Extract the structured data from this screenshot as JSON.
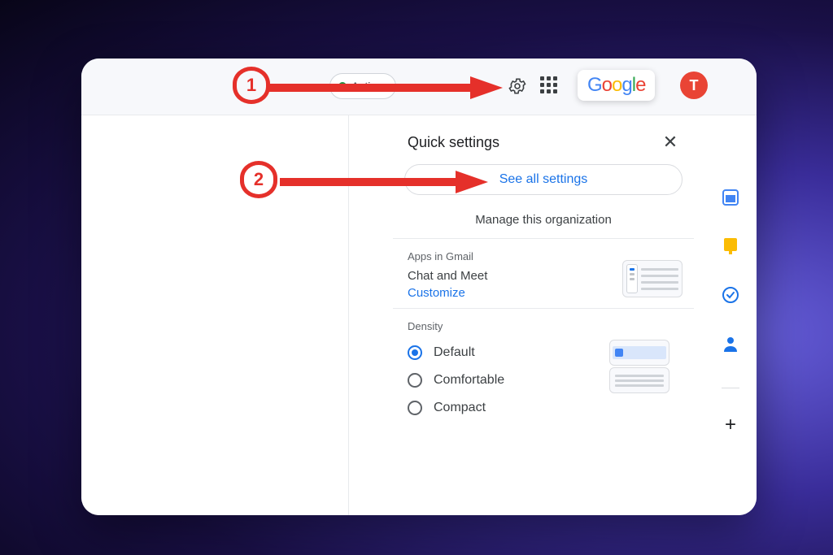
{
  "header": {
    "active_label": "Active",
    "logo_letters": [
      "G",
      "o",
      "o",
      "g",
      "l",
      "e"
    ],
    "avatar_initial": "T"
  },
  "panel": {
    "title": "Quick settings",
    "see_all_label": "See all settings",
    "manage_org_label": "Manage this organization",
    "apps_section_label": "Apps in Gmail",
    "apps_item_label": "Chat and Meet",
    "apps_customize_label": "Customize",
    "density_section_label": "Density",
    "density_options": [
      {
        "label": "Default",
        "selected": true
      },
      {
        "label": "Comfortable",
        "selected": false
      },
      {
        "label": "Compact",
        "selected": false
      }
    ]
  },
  "annotations": {
    "one": "1",
    "two": "2"
  },
  "colors": {
    "accent": "#1a73e8",
    "annotation_red": "#e5302a",
    "avatar": "#e94435"
  }
}
